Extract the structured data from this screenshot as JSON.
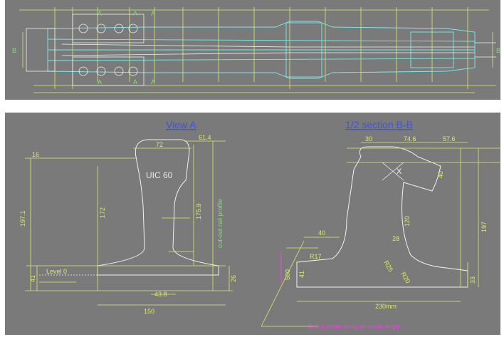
{
  "top_drawing": {
    "marks": [
      "B",
      "B",
      "A",
      "A",
      "A",
      "A",
      "A",
      "A"
    ]
  },
  "view_a": {
    "title": "View A",
    "profile": "UIC 60",
    "dims": {
      "d72": "72",
      "d614": "61.4",
      "d172": "172",
      "d1759": "175.9",
      "d1971": "197.1",
      "d41": "41",
      "d26": "26",
      "d438": "43.8",
      "d150": "150",
      "d16": "16",
      "level": "Level 0",
      "cutout": "cut-out rail profile"
    }
  },
  "section_bb": {
    "title": "1/2 section B-B",
    "marker": "X",
    "dims": {
      "d30": "30",
      "d746": "74.6",
      "d576": "57.6",
      "d40a": "40",
      "d40b": "40",
      "d120": "120",
      "d28": "28",
      "d197": "197",
      "d41": "41",
      "d33": "33",
      "d230": "230mm",
      "d500": "500",
      "r825": "R25",
      "r820": "R20",
      "r817": "R17"
    },
    "note": "Cutout profile along the whole length"
  }
}
